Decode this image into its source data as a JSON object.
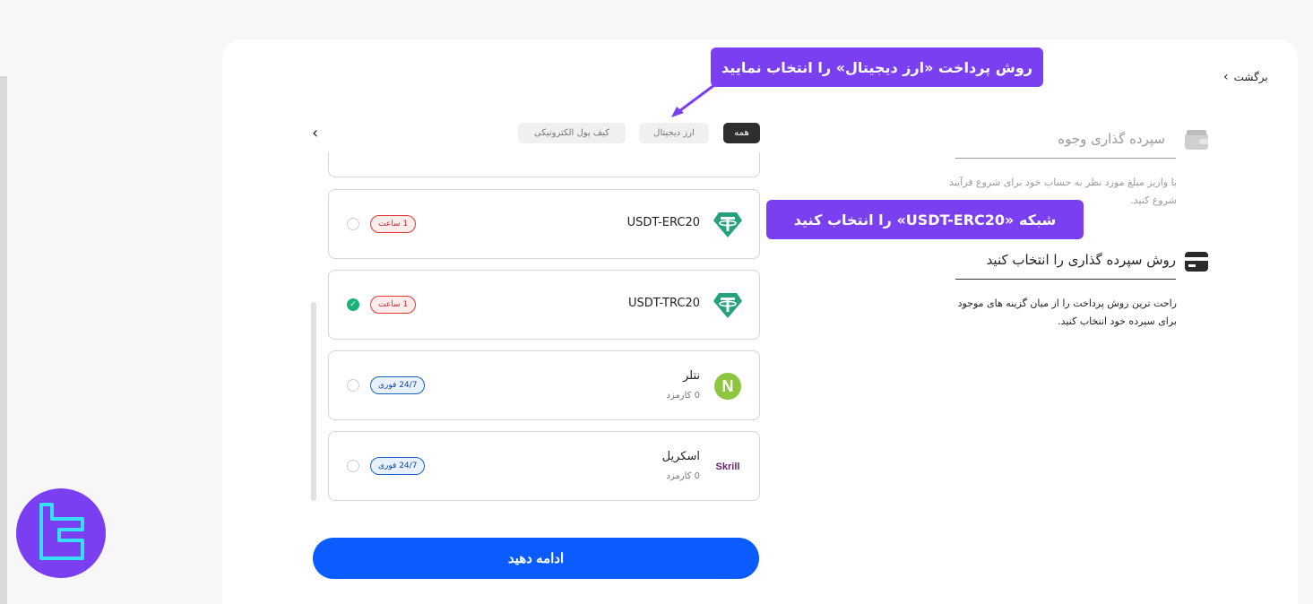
{
  "nav": {
    "back_label": "برگشت"
  },
  "steps": [
    {
      "title": "سپرده گذاری وجوه",
      "description": "با واریز مبلغ مورد نظر به حساب خود برای شروع فرآیند شروع کنید.",
      "icon": "wallet-icon",
      "state": "done"
    },
    {
      "title": "روش سپرده گذاری را انتخاب کنید",
      "description": "راحت ترین روش پرداخت را از میان گزینه های موجود برای سپرده خود انتخاب کنید.",
      "icon": "card-icon",
      "state": "active"
    }
  ],
  "tabs": [
    {
      "label": "همه",
      "active": true
    },
    {
      "label": "ارز دیجیتال",
      "active": false
    },
    {
      "label": "کیف پول الکترونیکی",
      "active": false
    }
  ],
  "methods": [
    {
      "name": "USDT-ERC20",
      "fee": "",
      "badge": "1 ساعت",
      "badge_style": "red",
      "selected": false,
      "logo": "tether-icon"
    },
    {
      "name": "USDT-TRC20",
      "fee": "",
      "badge": "1 ساعت",
      "badge_style": "red",
      "selected": true,
      "logo": "tether-icon"
    },
    {
      "name": "نتلر",
      "fee": "0 کارمزد",
      "badge": "24/7 فوری",
      "badge_style": "blue",
      "selected": false,
      "logo": "neteller-icon"
    },
    {
      "name": "اسکریل",
      "fee": "0 کارمزد",
      "badge": "24/7 فوری",
      "badge_style": "blue",
      "selected": false,
      "logo": "skrill-icon"
    }
  ],
  "continue_label": "ادامه دهید",
  "annotations": {
    "top": "روش پرداخت «ارز دیجیتال» را انتخاب نمایید",
    "middle": "شبکه «USDT-ERC20» را انتخاب کنید"
  },
  "logo_texts": {
    "skrill": "Skrill",
    "neteller": "N"
  },
  "colors": {
    "accent": "#0b5cff",
    "annotation": "#7b3ff2",
    "tether": "#26a17b",
    "success": "#19b37a"
  }
}
